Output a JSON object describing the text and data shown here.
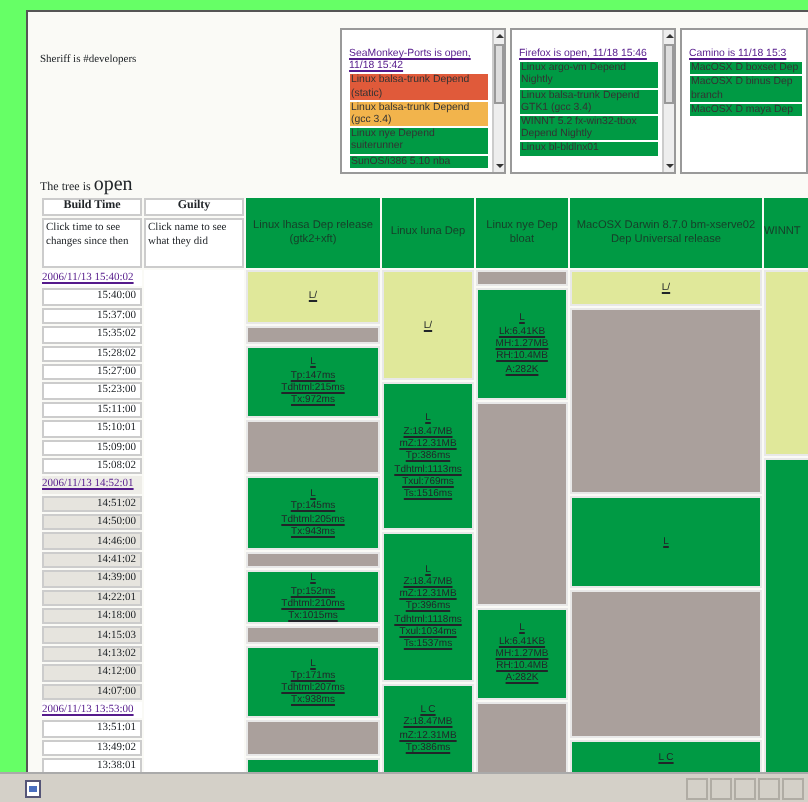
{
  "sheriff": "Sheriff is #developers",
  "trees": [
    {
      "title": "SeaMonkey-Ports is open, 11/18 15:42",
      "items": [
        {
          "label": "Linux balsa-trunk Depend (static)",
          "color": "#e05a3a"
        },
        {
          "label": "Linux balsa-trunk Depend (gcc 3.4)",
          "color": "#f2b44c"
        },
        {
          "label": "Linux nye Depend suiterunner",
          "color": "#009a44"
        },
        {
          "label": "SunOS/i386 5.10 nba",
          "color": "#009a44"
        }
      ]
    },
    {
      "title": "Firefox is open, 11/18 15:46",
      "items": [
        {
          "label": "Linux argo-vm Depend Nightly",
          "color": "#009a44"
        },
        {
          "label": "Linux balsa-trunk Depend GTK1 (gcc 3.4)",
          "color": "#009a44"
        },
        {
          "label": "WINNT 5.2 fx-win32-tbox Depend Nightly",
          "color": "#009a44"
        },
        {
          "label": "Linux bl-bldlnx01",
          "color": "#009a44"
        }
      ]
    },
    {
      "title": "Camino is 11/18 15:3",
      "items": [
        {
          "label": "MacOSX D boxset Dep",
          "color": "#009a44"
        },
        {
          "label": "MacOSX D binus Dep branch",
          "color": "#009a44"
        },
        {
          "label": "MacOSX D maya Dep",
          "color": "#009a44"
        }
      ]
    }
  ],
  "tree_status": {
    "label": "The tree is",
    "state": "open"
  },
  "table": {
    "time_header": "Build Time",
    "guilty_header": "Guilty",
    "time_hint": "Click time to see changes since then",
    "guilty_hint": "Click name to see what they did",
    "times": [
      {
        "text": "2006/11/13 15:40:02",
        "kind": "link",
        "shaded": false
      },
      {
        "text": "15:40:00",
        "kind": "time",
        "shaded": false
      },
      {
        "text": "15:37:00",
        "kind": "time",
        "shaded": false
      },
      {
        "text": "15:35:02",
        "kind": "time",
        "shaded": false
      },
      {
        "text": "15:28:02",
        "kind": "time",
        "shaded": false
      },
      {
        "text": "15:27:00",
        "kind": "time",
        "shaded": false
      },
      {
        "text": "15:23:00",
        "kind": "time",
        "shaded": false
      },
      {
        "text": "15:11:00",
        "kind": "time",
        "shaded": false
      },
      {
        "text": "15:10:01",
        "kind": "time",
        "shaded": false
      },
      {
        "text": "15:09:00",
        "kind": "time",
        "shaded": false
      },
      {
        "text": "15:08:02",
        "kind": "time",
        "shaded": false
      },
      {
        "text": "2006/11/13 14:52:01",
        "kind": "link",
        "shaded": true
      },
      {
        "text": "14:51:02",
        "kind": "time",
        "shaded": true
      },
      {
        "text": "14:50:00",
        "kind": "time",
        "shaded": true
      },
      {
        "text": "14:46:00",
        "kind": "time",
        "shaded": true
      },
      {
        "text": "14:41:02",
        "kind": "time",
        "shaded": true
      },
      {
        "text": "14:39:00",
        "kind": "time",
        "shaded": true
      },
      {
        "text": "14:22:01",
        "kind": "time",
        "shaded": true
      },
      {
        "text": "14:18:00",
        "kind": "time",
        "shaded": true
      },
      {
        "text": "14:15:03",
        "kind": "time",
        "shaded": true
      },
      {
        "text": "14:13:02",
        "kind": "time",
        "shaded": true
      },
      {
        "text": "14:12:00",
        "kind": "time",
        "shaded": true
      },
      {
        "text": "14:07:00",
        "kind": "time",
        "shaded": true
      },
      {
        "text": "2006/11/13 13:53:00",
        "kind": "link",
        "shaded": false
      },
      {
        "text": "13:51:01",
        "kind": "time",
        "shaded": false
      },
      {
        "text": "13:49:02",
        "kind": "time",
        "shaded": false
      },
      {
        "text": "13:38:01",
        "kind": "time",
        "shaded": false
      }
    ],
    "builds": [
      {
        "name": "Linux lhasa Dep release (gtk2+xft)",
        "cells": [
          {
            "kind": "building",
            "rowspan": 3,
            "lines": [
              "L/"
            ]
          },
          {
            "kind": "unknown"
          },
          {
            "kind": "success",
            "rowspan": 4,
            "lines": [
              "L",
              "Tp:147ms",
              "Tdhtml:215ms",
              "Tx:972ms"
            ]
          },
          {
            "kind": "unknown",
            "rowspan": 3
          },
          {
            "kind": "success",
            "rowspan": 4,
            "lines": [
              "L",
              "Tp:145ms",
              "Tdhtml:205ms",
              "Tx:943ms"
            ]
          },
          {
            "kind": "unknown"
          },
          {
            "kind": "success",
            "rowspan": 3,
            "lines": [
              "L",
              "Tp:152ms",
              "Tdhtml:210ms",
              "Tx:1015ms"
            ]
          },
          {
            "kind": "unknown"
          },
          {
            "kind": "success",
            "rowspan": 4,
            "lines": [
              "L",
              "Tp:171ms",
              "Tdhtml:207ms",
              "Tx:938ms"
            ]
          },
          {
            "kind": "unknown",
            "rowspan": 2
          },
          {
            "kind": "success"
          }
        ]
      },
      {
        "name": "Linux luna Dep",
        "cells": [
          {
            "kind": "building",
            "rowspan": 6,
            "lines": [
              "L/"
            ]
          },
          {
            "kind": "success",
            "rowspan": 8,
            "lines": [
              "L",
              "Z:18.47MB",
              "mZ:12.31MB",
              "Tp:386ms",
              "Tdhtml:1113ms",
              "Txul:769ms",
              "Ts:1516ms"
            ]
          },
          {
            "kind": "success",
            "rowspan": 8,
            "lines": [
              "L",
              "Z:18.47MB",
              "mZ:12.31MB",
              "Tp:396ms",
              "Tdhtml:1118ms",
              "Txul:1034ms",
              "Ts:1537ms"
            ]
          },
          {
            "kind": "success",
            "rowspan": 5,
            "lines": [
              "L C",
              "Z:18.47MB",
              "mZ:12.31MB",
              "Tp:386ms"
            ]
          }
        ]
      },
      {
        "name": "Linux nye Dep bloat",
        "cells": [
          {
            "kind": "unknown"
          },
          {
            "kind": "success",
            "rowspan": 6,
            "lines": [
              "L",
              "Lk:6.41KB",
              "MH:1.27MB",
              "RH:10.4MB",
              "A:282K"
            ]
          },
          {
            "kind": "unknown",
            "rowspan": 11
          },
          {
            "kind": "success",
            "rowspan": 5,
            "lines": [
              "L",
              "Lk:6.41KB",
              "MH:1.27MB",
              "RH:10.4MB",
              "A:282K"
            ]
          },
          {
            "kind": "unknown",
            "rowspan": 4
          }
        ]
      },
      {
        "name": "MacOSX Darwin 8.7.0 bm-xserve02 Dep Universal release",
        "cells": [
          {
            "kind": "building",
            "rowspan": 2,
            "lines": [
              "L/"
            ]
          },
          {
            "kind": "unknown",
            "rowspan": 10
          },
          {
            "kind": "success",
            "rowspan": 5,
            "lines": [
              "L"
            ]
          },
          {
            "kind": "unknown",
            "rowspan": 8
          },
          {
            "kind": "success",
            "rowspan": 2,
            "lines": [
              "L C"
            ]
          }
        ]
      },
      {
        "name": "WINNT",
        "cells": [
          {
            "kind": "building",
            "rowspan": 10
          },
          {
            "kind": "success",
            "rowspan": 17
          }
        ]
      }
    ]
  }
}
